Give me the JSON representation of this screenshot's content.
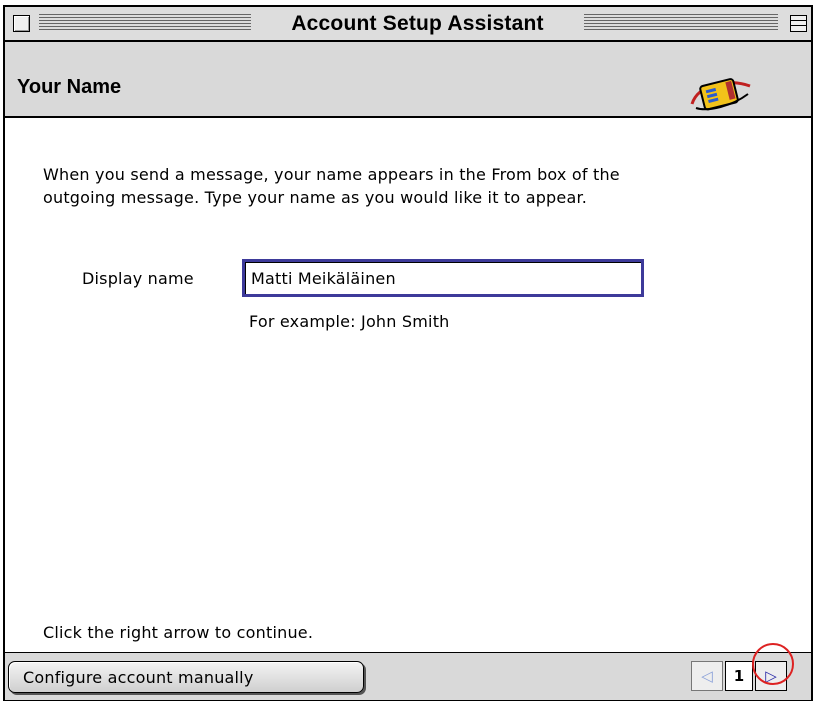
{
  "window": {
    "title": "Account Setup Assistant"
  },
  "header": {
    "page_title": "Your Name",
    "logo_icon": "mail-envelope-logo-icon"
  },
  "main": {
    "intro_line1": "When you send a message, your name appears in the From box of the",
    "intro_line2": "outgoing message. Type your name as you would like it to appear.",
    "display_name_label": "Display name",
    "display_name_value": "Matti Meikäläinen",
    "example_text": "For example: John Smith",
    "continue_hint": "Click the right arrow to continue."
  },
  "footer": {
    "configure_button": "Configure account manually",
    "prev_icon": "◁",
    "page_number": "1",
    "next_icon": "▷"
  },
  "colors": {
    "chrome": "#d9d9d9",
    "input_focus": "#3d3a9a",
    "highlight_ring": "#dd2222"
  }
}
